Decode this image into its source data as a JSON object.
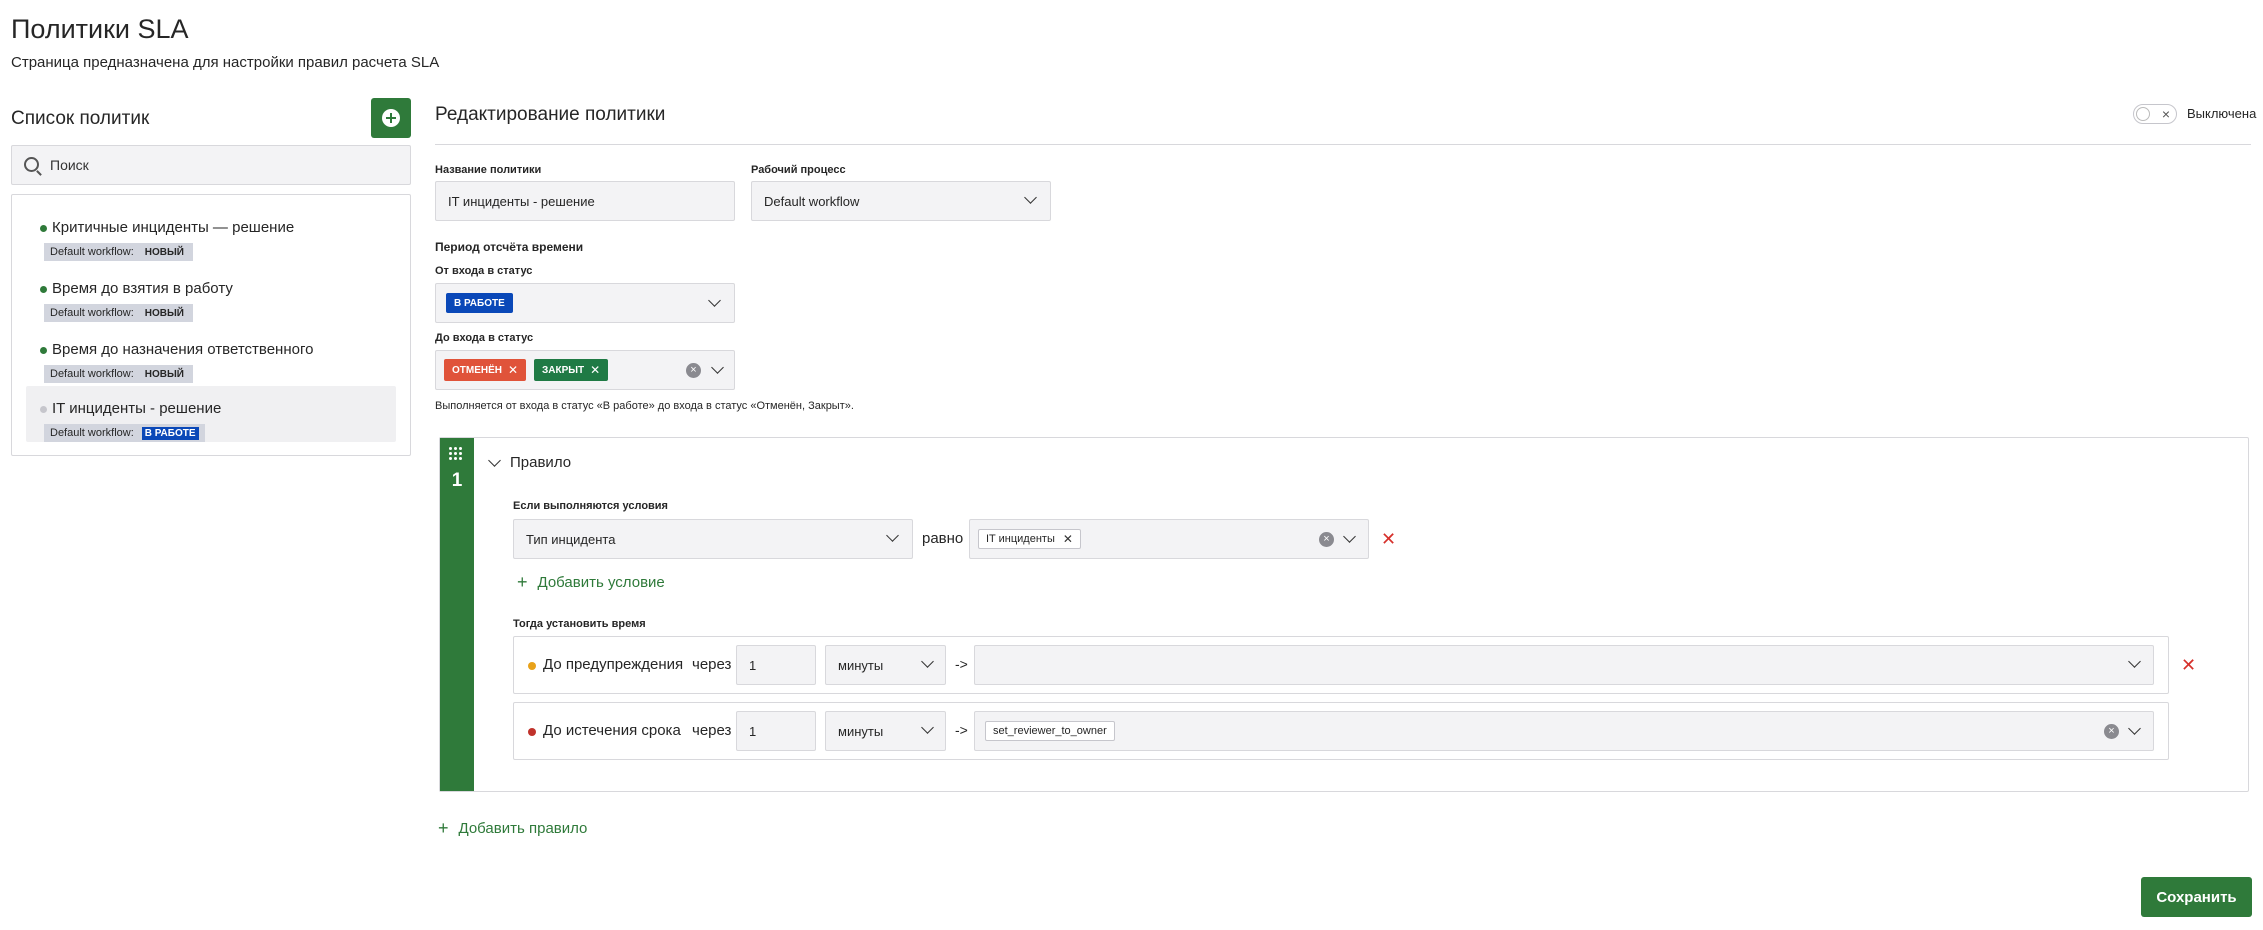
{
  "header": {
    "title": "Политики SLA",
    "subtitle": "Страница предназначена для настройки правил расчета SLA"
  },
  "sidebar": {
    "title": "Список политик",
    "search_placeholder": "Поиск",
    "items": [
      {
        "name": "Критичные инциденты — решение",
        "workflow": "Default workflow:",
        "status": "НОВЫЙ",
        "active": true,
        "selected": false
      },
      {
        "name": "Время до взятия в работу",
        "workflow": "Default workflow:",
        "status": "НОВЫЙ",
        "active": true,
        "selected": false
      },
      {
        "name": "Время до назначения ответственного",
        "workflow": "Default workflow:",
        "status": "НОВЫЙ",
        "active": true,
        "selected": false
      },
      {
        "name": "IT инциденты - решение",
        "workflow": "Default workflow:",
        "status": "В РАБОТЕ",
        "active": false,
        "selected": true
      }
    ]
  },
  "editor": {
    "title": "Редактирование политики",
    "toggle_label": "Выключена",
    "policy_name_label": "Название политики",
    "policy_name_value": "IT инциденты - решение",
    "workflow_label": "Рабочий процесс",
    "workflow_value": "Default workflow",
    "period_label": "Период отсчёта времени",
    "from_status_label": "От входа в статус",
    "from_status_chip": "В РАБОТЕ",
    "to_status_label": "До входа в статус",
    "to_status_chips": [
      "ОТМЕНЁН",
      "ЗАКРЫТ"
    ],
    "period_hint": "Выполняется от входа в статус «В работе» до входа в статус «Отменён, Закрыт».",
    "colors": {
      "accent": "#2f7a3a",
      "in_work": "#0a48b8",
      "cancelled": "#e0533a",
      "closed": "#1f7a45",
      "warning": "#e8a21a",
      "deadline": "#c0322b",
      "danger": "#d6302b"
    }
  },
  "rule": {
    "number": "1",
    "title": "Правило",
    "conditions_label": "Если выполняются условия",
    "condition_field": "Тип инцидента",
    "condition_operator": "равно",
    "condition_value_chip": "IT инциденты",
    "add_condition": "Добавить условие",
    "time_label": "Тогда установить время",
    "times": [
      {
        "name": "До предупреждения",
        "through": "через",
        "amount": "1",
        "unit": "минуты",
        "arrow": "->",
        "action": ""
      },
      {
        "name": "До истечения срока",
        "through": "через",
        "amount": "1",
        "unit": "минуты",
        "arrow": "->",
        "action": "set_reviewer_to_owner"
      }
    ]
  },
  "add_rule": "Добавить правило",
  "save_label": "Сохранить"
}
